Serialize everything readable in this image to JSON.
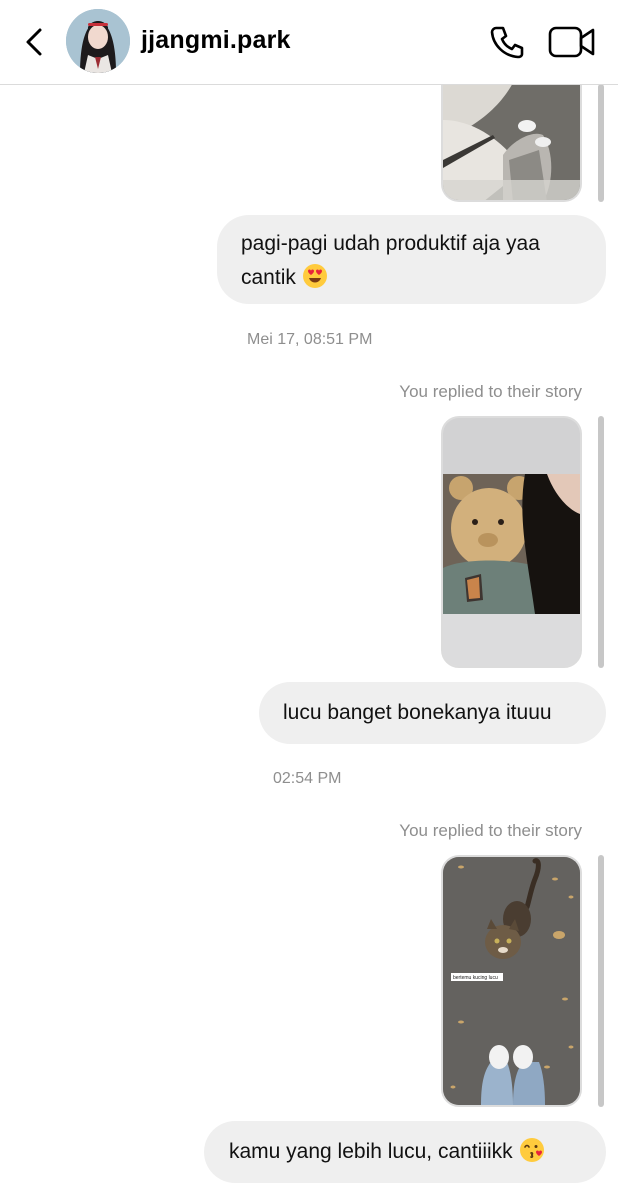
{
  "header": {
    "username": "jjangmi.park"
  },
  "messages": {
    "m1": "pagi-pagi udah produktif aja yaa",
    "m1b": "cantik",
    "ts1": "Mei 17, 08:51 PM",
    "replied1": "You replied to their story",
    "m2": "lucu banget bonekanya ituuu",
    "ts2": "02:54 PM",
    "replied2": "You replied to their story",
    "story3_caption": "bertemu kucing lucu",
    "m3": "kamu yang lebih lucu, cantiiikk"
  },
  "icons": {
    "back": "chevron-left-icon",
    "call": "phone-icon",
    "video": "video-camera-icon",
    "emoji1": "heart-eyes-emoji",
    "emoji2": "kissing-face-emoji"
  },
  "colors": {
    "bubble": "#efefef",
    "muted_text": "#8e8e8e"
  }
}
